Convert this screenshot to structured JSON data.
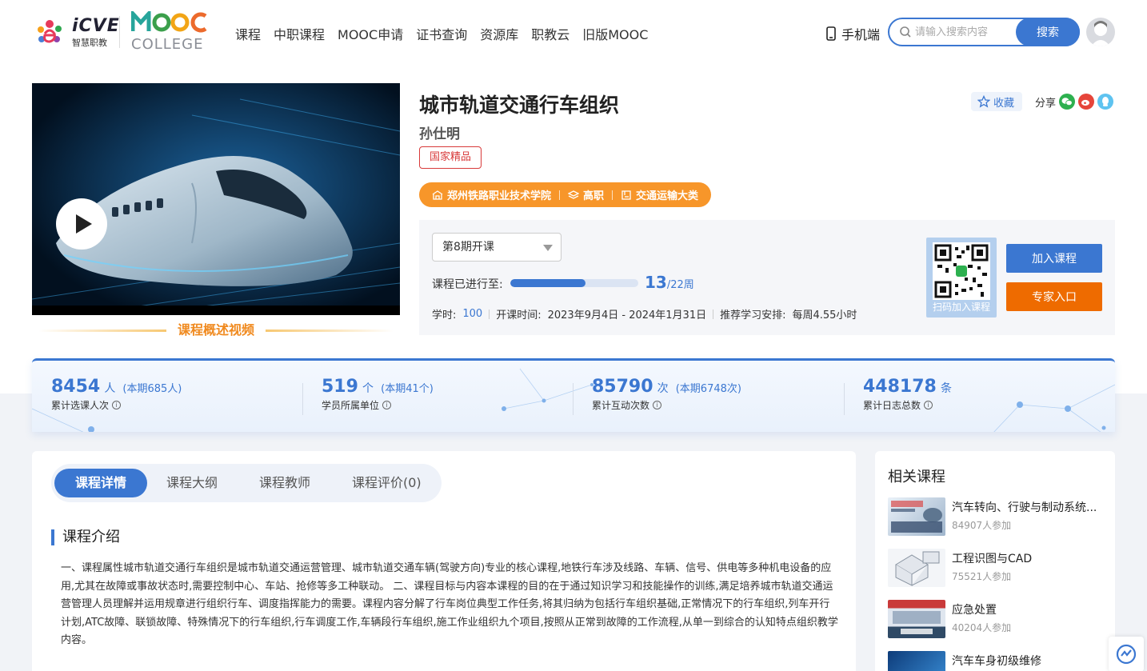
{
  "brand": {
    "icve_name": "iCVE",
    "icve_sub": "智慧职教",
    "mooc_name": "MOOC",
    "mooc_sub": "COLLEGE"
  },
  "nav": {
    "items": [
      "课程",
      "中职课程",
      "MOOC申请",
      "证书查询",
      "资源库",
      "职教云",
      "旧版MOOC"
    ],
    "mobile_label": "手机端"
  },
  "search": {
    "placeholder": "请输入搜索内容",
    "button_label": "搜索"
  },
  "video": {
    "caption": "课程概述视频"
  },
  "course": {
    "title": "城市轨道交通行车组织",
    "teacher": "孙仕明",
    "badge": "国家精品",
    "favorite_label": "收藏",
    "share_label": "分享",
    "school": "郑州铁路职业技术学院",
    "level": "高职",
    "category": "交通运输大类"
  },
  "session": {
    "selected": "第8期开课",
    "progress_label": "课程已进行至:",
    "current_week": "13",
    "total_weeks_text": "/22周",
    "progress_fraction": 0.59,
    "hours_label": "学时:",
    "hours_value": "100",
    "period_label": "开课时间:",
    "period_value": "2023年9月4日 - 2024年1月31日",
    "recommend_label": "推荐学习安排:",
    "recommend_value": "每周4.55小时",
    "qr_caption": "扫码加入课程",
    "join_button": "加入课程",
    "expert_button": "专家入口"
  },
  "stats": [
    {
      "num": "8454",
      "unit": "人",
      "sub": "(本期685人)",
      "label": "累计选课人次"
    },
    {
      "num": "519",
      "unit": "个",
      "sub": "(本期41个)",
      "label": "学员所属单位"
    },
    {
      "num": "85790",
      "unit": "次",
      "sub": "(本期6748次)",
      "label": "累计互动次数"
    },
    {
      "num": "448178",
      "unit": "条",
      "sub": "",
      "label": "累计日志总数"
    }
  ],
  "tabs": [
    "课程详情",
    "课程大纲",
    "课程教师",
    "课程评价(0)"
  ],
  "intro": {
    "title": "课程介绍",
    "text": "一、课程属性城市轨道交通行车组织是城市轨道交通运营管理、城市轨道交通车辆(驾驶方向)专业的核心课程,地铁行车涉及线路、车辆、信号、供电等多种机电设备的应用,尤其在故障或事故状态时,需要控制中心、车站、抢修等多工种联动。 二、课程目标与内容本课程的目的在于通过知识学习和技能操作的训练,满足培养城市轨道交通运营管理人员理解并运用规章进行组织行车、调度指挥能力的需要。课程内容分解了行车岗位典型工作任务,将其归纳为包括行车组织基础,正常情况下的行车组织,列车开行计划,ATC故障、联锁故障、特殊情况下的行车组织,行车调度工作,车辆段行车组织,施工作业组织九个项目,按照从正常到故障的工作流程,从单一到综合的认知特点组织教学内容。"
  },
  "related": {
    "title": "相关课程",
    "items": [
      {
        "name": "汽车转向、行驶与制动系统...",
        "count": "84907人参加"
      },
      {
        "name": "工程识图与CAD",
        "count": "75521人参加"
      },
      {
        "name": "应急处置",
        "count": "40204人参加"
      },
      {
        "name": "汽车车身初级维修",
        "count": ""
      }
    ]
  },
  "colors": {
    "primary": "#3b77d1",
    "orange": "#f7962a",
    "expert": "#ee6b00",
    "badge_red": "#d83a3a"
  }
}
